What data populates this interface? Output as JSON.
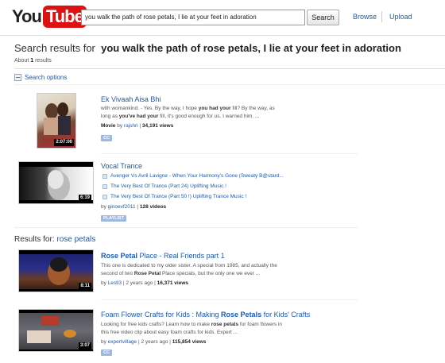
{
  "header": {
    "logo_you": "You",
    "logo_tube": "Tube",
    "search_value": "you walk the path of rose petals, I lie at your feet in adoration",
    "search_button": "Search",
    "nav_browse": "Browse",
    "nav_upload": "Upload"
  },
  "results": {
    "title_prefix": "Search results for ",
    "query": "you walk the path of rose petals, I lie at your feet in adoration",
    "count_prefix": "About ",
    "count_value": "1",
    "count_suffix": " results",
    "options_label": "Search options"
  },
  "items": [
    {
      "title": "Ek Vivaah Aisa Bhi",
      "desc1_a": "with womankind. - Yes. By the way, I hope ",
      "desc1_b": "you had your",
      "desc1_c": " fill? By the way, as",
      "desc2_a": "long as ",
      "desc2_b": "you've had your",
      "desc2_c": " fill, it's good enough for us. I warned him. ...",
      "meta_type": "Movie",
      "meta_by": " by ",
      "meta_author": "rajshri",
      "meta_views": "34,191 views",
      "badge": "CC",
      "duration": "2:07:00",
      "thumb_text": "Ek Vivaah"
    },
    {
      "title": "Vocal Trance",
      "rows": [
        "Avenger Vs Avril Lavigne - When Your Harmony's Gone (Sweaty B@stard...",
        "The Very Best Of Trance (Part 24) Uplifting Music !",
        "The Very Best Of Trance (Part 50 !) Uplifting Trance Music !"
      ],
      "meta_by": "by ",
      "meta_author": "ginoevf2011",
      "meta_videos": "128 videos",
      "badge": "PLAYLIST",
      "duration": "6:19"
    }
  ],
  "section": {
    "prefix": "Results for: ",
    "query": "rose petals"
  },
  "related": [
    {
      "title_a": "Rose Petal",
      "title_b": " Place - Real Friends part 1",
      "desc1": "This one is dedicated to my older sister. A special from 1985, and actually the",
      "desc2_a": "second of two ",
      "desc2_b": "Rose Petal",
      "desc2_c": " Place specials, but the only one we ever ...",
      "meta_by": "by ",
      "meta_author": "Lestl3",
      "meta_age": " | 2 years ago | ",
      "meta_views": "16,371 views",
      "duration": "8:11"
    },
    {
      "title_a": "Foam Flower Crafts for Kids : Making ",
      "title_b": "Rose Petals",
      "title_c": " for Kids' Crafts",
      "desc1_a": "Looking for free kids crafts? Learn how to make ",
      "desc1_b": "rose petals",
      "desc1_c": " for foam flowers in",
      "desc2": "this free video clip about easy foam crafts for kids. Expert ...",
      "meta_by": "by ",
      "meta_author": "expertvillage",
      "meta_age": " | 2 years ago | ",
      "meta_views": "115,854 views",
      "badge": "CC",
      "duration": "3:07"
    }
  ],
  "colors": {
    "link": "#1a5bb4",
    "logo_red": "#dd1111",
    "badge": "#9fb8e0"
  }
}
